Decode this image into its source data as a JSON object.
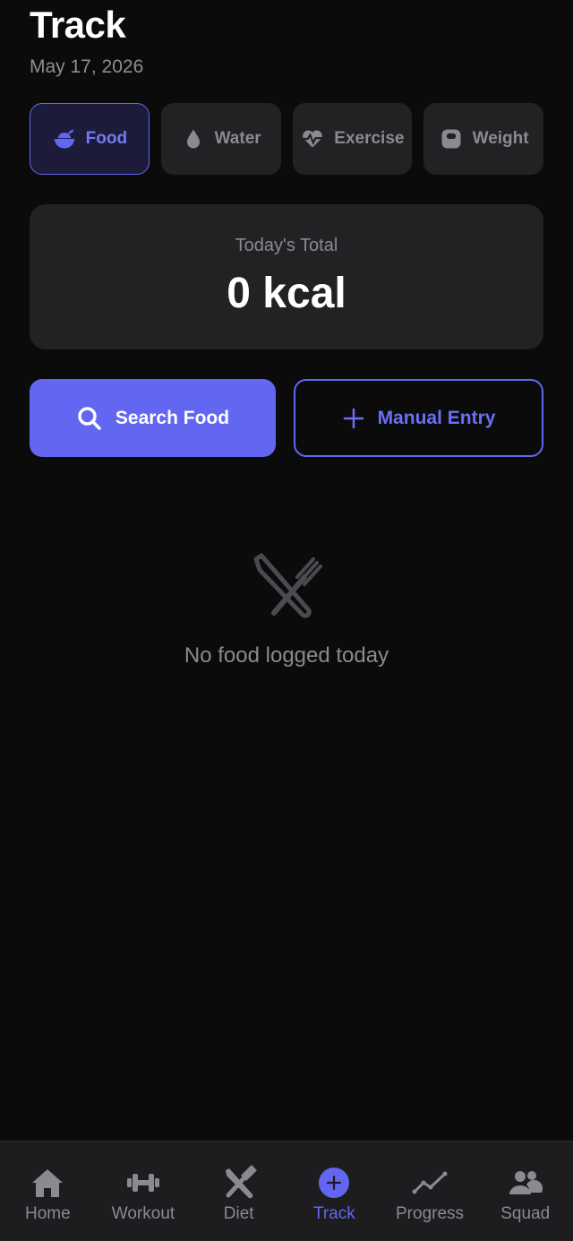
{
  "header": {
    "title": "Track",
    "date": "May 17, 2026"
  },
  "tabs": [
    {
      "label": "Food",
      "icon": "food-icon",
      "active": true
    },
    {
      "label": "Water",
      "icon": "water-drop-icon",
      "active": false
    },
    {
      "label": "Exercise",
      "icon": "heart-pulse-icon",
      "active": false
    },
    {
      "label": "Weight",
      "icon": "kettlebell-icon",
      "active": false
    }
  ],
  "total": {
    "label": "Today's Total",
    "value": "0 kcal"
  },
  "actions": {
    "search_label": "Search Food",
    "manual_label": "Manual Entry"
  },
  "empty_state": {
    "icon": "utensils-icon",
    "text": "No food logged today"
  },
  "nav": [
    {
      "label": "Home",
      "icon": "home-icon",
      "active": false
    },
    {
      "label": "Workout",
      "icon": "dumbbell-icon",
      "active": false
    },
    {
      "label": "Diet",
      "icon": "utensils-icon",
      "active": false
    },
    {
      "label": "Track",
      "icon": "plus-circle-icon",
      "active": true
    },
    {
      "label": "Progress",
      "icon": "trend-line-icon",
      "active": false
    },
    {
      "label": "Squad",
      "icon": "users-icon",
      "active": false
    }
  ],
  "colors": {
    "accent": "#6366f1",
    "background": "#0b0b0c",
    "card": "#222224",
    "muted": "#8a8a90"
  }
}
